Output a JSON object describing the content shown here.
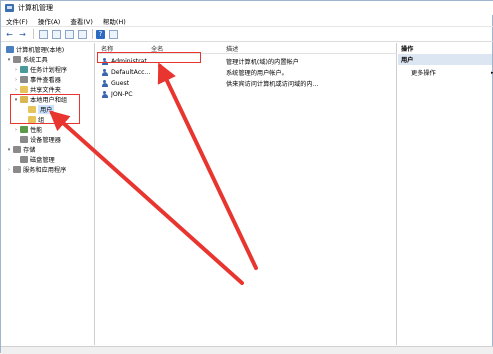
{
  "window": {
    "title": "计算机管理"
  },
  "menubar": {
    "items": [
      "文件(F)",
      "操作(A)",
      "查看(V)",
      "帮助(H)"
    ]
  },
  "toolbar": {
    "back": "←",
    "forward": "→",
    "help": "?"
  },
  "tree": {
    "items": [
      {
        "label": "计算机管理(本地)",
        "twisty": "",
        "icon": "computer-icon"
      },
      {
        "label": "系统工具",
        "twisty": "▾",
        "icon": "tools-icon"
      },
      {
        "label": "任务计划程序",
        "twisty": "›",
        "icon": "clock-icon"
      },
      {
        "label": "事件查看器",
        "twisty": "›",
        "icon": "log-icon"
      },
      {
        "label": "共享文件夹",
        "twisty": "›",
        "icon": "folder-icon"
      },
      {
        "label": "本地用户和组",
        "twisty": "▾",
        "icon": "users-icon"
      },
      {
        "label": "用户",
        "twisty": "",
        "icon": "folder-icon"
      },
      {
        "label": "组",
        "twisty": "",
        "icon": "folder-icon"
      },
      {
        "label": "性能",
        "twisty": "›",
        "icon": "chart-icon"
      },
      {
        "label": "设备管理器",
        "twisty": "",
        "icon": "device-icon"
      },
      {
        "label": "存储",
        "twisty": "▾",
        "icon": "storage-icon"
      },
      {
        "label": "磁盘管理",
        "twisty": "",
        "icon": "disk-icon"
      },
      {
        "label": "服务和应用程序",
        "twisty": "›",
        "icon": "services-icon"
      }
    ]
  },
  "list": {
    "columns": {
      "name": "名称",
      "fullname": "全名",
      "description": "描述"
    },
    "rows": [
      {
        "name": "Administrat...",
        "fullname": "",
        "description": "管理计算机(域)的内置帐户"
      },
      {
        "name": "DefaultAcc...",
        "fullname": "",
        "description": "系统管理的用户帐户。"
      },
      {
        "name": "Guest",
        "fullname": "",
        "description": "供来宾访问计算机或访问域的内..."
      },
      {
        "name": "JON-PC",
        "fullname": "",
        "description": ""
      }
    ]
  },
  "actions": {
    "header": "操作",
    "group": "用户",
    "more": "更多操作",
    "more_arrow": "▸"
  },
  "colors": {
    "annotation": "#e8352f",
    "selection": "#cce4ff",
    "actions_group": "#dce6f2"
  }
}
